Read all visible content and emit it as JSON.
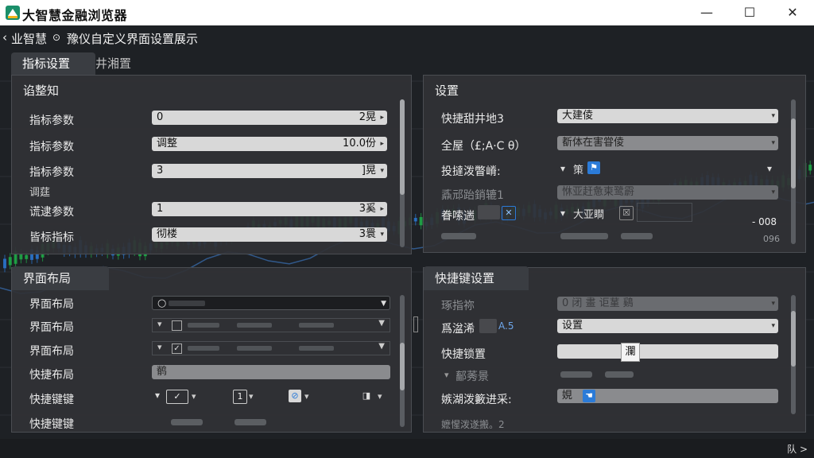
{
  "window": {
    "title": "大智慧金融浏览器",
    "minimize": "—",
    "maximize": "☐",
    "close": "✕"
  },
  "breadcrumb": {
    "back": "‹",
    "root": "业智慧",
    "sep": "⊙",
    "page": "豫仪自定义界面设置展示"
  },
  "tabs": [
    {
      "label": "指标设置"
    },
    {
      "label": "井湘置"
    }
  ],
  "left_top": {
    "title": "谄整知",
    "rows": [
      {
        "label": "指标参数",
        "value": "0",
        "right": "2晃"
      },
      {
        "label": "指标参数",
        "value": "调整",
        "right": "10.0份"
      },
      {
        "label": "指标参数",
        "value": "3",
        "right": "]晃"
      },
      {
        "label": "调莛",
        "value": "",
        "right": ""
      },
      {
        "label": "谎逮参数",
        "value": "1",
        "right": "3奚"
      },
      {
        "label": "皆标指标",
        "value": "彻楼",
        "right": "3睘"
      }
    ]
  },
  "right_top": {
    "title": "设置",
    "rows": [
      {
        "label": "快捷甜井地3",
        "value": "大建倰"
      },
      {
        "label": "全屋（£;A·C θ）",
        "value": "斱体在害甞倰"
      },
      {
        "label": "投撻泼瞥嵴:",
        "value": "策"
      },
      {
        "label": "鼒邧跆銷辘1",
        "value": "恘亚赶惫柬鹭霨"
      },
      {
        "label": "眷嗦遄",
        "value": "大亚瞷"
      }
    ],
    "readout": "- 008",
    "readout2": "096"
  },
  "left_bottom": {
    "title": "界面布局",
    "rows": [
      {
        "label": "界面布局",
        "value": "○"
      },
      {
        "label": "界面布局",
        "value": ""
      },
      {
        "label": "界面布局",
        "value": ""
      },
      {
        "label": "快捷布局",
        "value": "鹡"
      },
      {
        "label": "快捷键键",
        "value": "1"
      },
      {
        "label": "快捷键键",
        "value": ""
      }
    ]
  },
  "right_bottom": {
    "title": "快捷键设置",
    "rows": [
      {
        "label": "琢指祢",
        "value": "0 闭 畫 讵蓳 鷄"
      },
      {
        "label": "爲湓浠",
        "value": "设置",
        "extra": "A.5"
      },
      {
        "label": "快捷锁置",
        "value": "",
        "button": "瀾"
      },
      {
        "label": "鄐莠景",
        "value": ""
      },
      {
        "label": "嫉湖泼籔进采:",
        "value": "娊"
      },
      {
        "label": "嬷惺泼遂搬。2",
        "value": ""
      }
    ]
  },
  "status": {
    "right": "队 >"
  },
  "colors": {
    "bg": "#1e2125",
    "panel": "#303236",
    "up": "#1fb24a",
    "down": "#2b7bd8",
    "accent": "#2b7bd8"
  }
}
